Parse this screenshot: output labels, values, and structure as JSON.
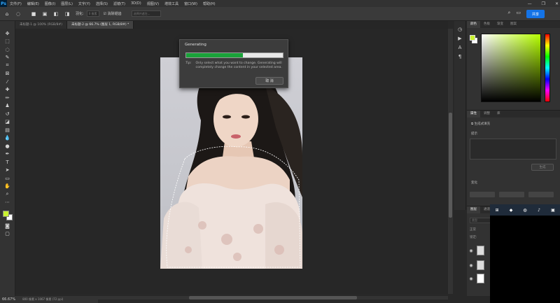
{
  "app": {
    "logo": "Ps"
  },
  "menu": [
    "文件(F)",
    "编辑(E)",
    "图像(I)",
    "图层(L)",
    "文字(Y)",
    "选择(S)",
    "滤镜(T)",
    "3D(D)",
    "视图(V)",
    "增效工具",
    "窗口(W)",
    "帮助(H)"
  ],
  "window_controls": {
    "minimize": "—",
    "maximize": "❐",
    "close": "✕"
  },
  "options": {
    "feather_label": "羽化:",
    "feather_value": "0 像素",
    "antialias_label": "消除锯齿",
    "select_subject_label": "选择并遮住...",
    "share_label": "共享"
  },
  "tabs": [
    {
      "label": "未标题-1 @ 100% (RGB/8#)",
      "active": false
    },
    {
      "label": "未标题-2 @ 66.7% (图层 1, RGB/8#) *",
      "active": true
    }
  ],
  "dialog": {
    "title": "Generating",
    "progress": 0.59,
    "tip_label": "Tip:",
    "tip_text": "Only select what you want to change. Generating will completely change the content in your selected area.",
    "cancel_label": "取 消"
  },
  "status": {
    "zoom": "66.67%",
    "doc_info": "800 像素 x 1067 像素 (72 ppi)"
  },
  "color_panel": {
    "tabs": [
      "颜色",
      "色板",
      "渐变",
      "图案"
    ]
  },
  "properties_panel": {
    "tabs": [
      "属性",
      "调整",
      "库"
    ],
    "layer_type": "生成式填充",
    "prompt_label": "提示",
    "generate_label": "生成",
    "variations_label": "变化"
  },
  "layers_panel": {
    "tabs": [
      "图层",
      "通道"
    ],
    "search_placeholder": "类型",
    "mode_label": "正常",
    "lock_label": "锁定:"
  },
  "colors": {
    "foreground": "#c9f230",
    "background": "#ffffff",
    "accent": "#1473e6",
    "progress": "#1aa33a"
  }
}
